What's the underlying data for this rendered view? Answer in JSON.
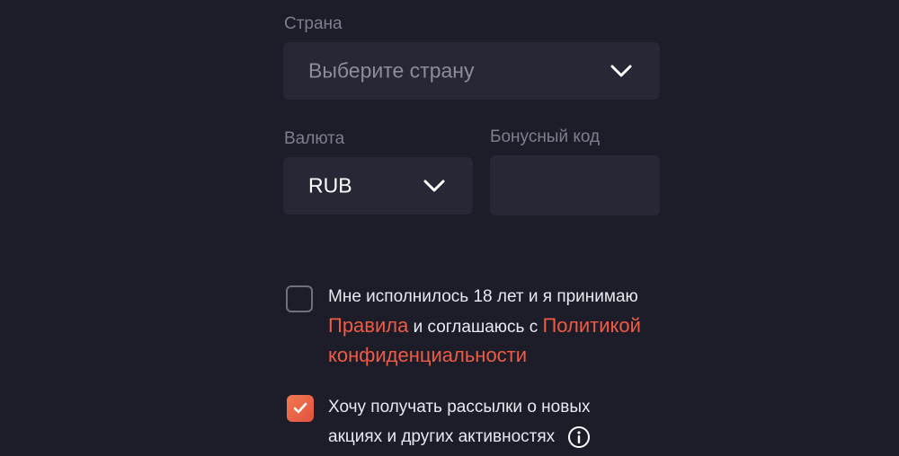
{
  "country": {
    "label": "Страна",
    "placeholder": "Выберите страну"
  },
  "currency": {
    "label": "Валюта",
    "value": "RUB"
  },
  "bonus": {
    "label": "Бонусный код",
    "value": ""
  },
  "terms": {
    "checked": false,
    "line1": "Мне исполнилось 18 лет и я принимаю",
    "rules_link": "Правила",
    "middle": " и соглашаюсь с ",
    "policy_link_part1": "Политикой",
    "policy_link_part2": "конфиденциальности"
  },
  "newsletter": {
    "checked": true,
    "line1": "Хочу получать рассылки о новых",
    "line2": "акциях и других активностях",
    "icon": "info-icon"
  },
  "colors": {
    "background": "#1c1d29",
    "field": "#262836",
    "accent": "#ef5b44",
    "label": "#7d7f8c",
    "text": "#e8e9ee"
  }
}
